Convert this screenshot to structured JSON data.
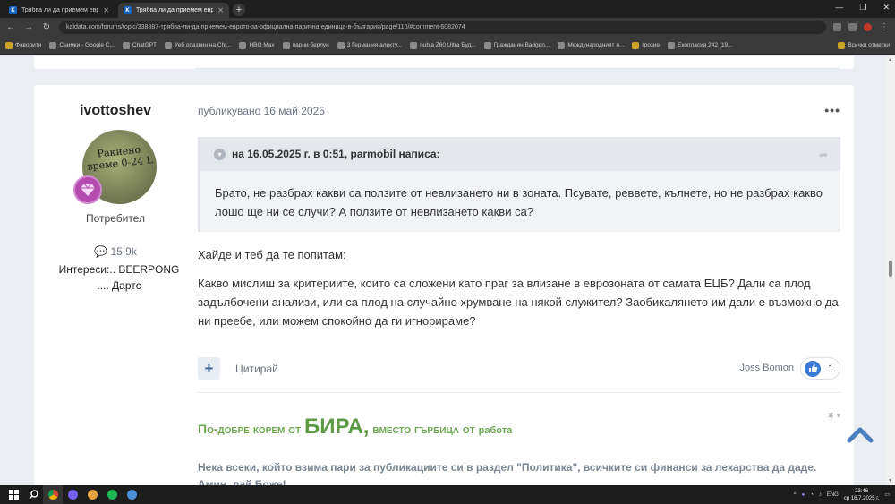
{
  "browser": {
    "tabs": [
      {
        "favicon": "K",
        "title": "Трябва ли да приемем еврото…",
        "active": false
      },
      {
        "favicon": "K",
        "title": "Трябва ли да приемем еврото…",
        "active": true
      }
    ],
    "url": "kaldata.com/forums/topic/338887-трябва-ли-да-приемем-еврото-за-официална-парична-единица-в-българия/page/110/#comment-6082074",
    "bookmarks": [
      {
        "label": "Фаворити",
        "type": "folder"
      },
      {
        "label": "Снимки - Google С...",
        "type": "link"
      },
      {
        "label": "ChatGPT",
        "type": "link"
      },
      {
        "label": "Уеб опазвин на Chr...",
        "type": "link"
      },
      {
        "label": "HBO Max",
        "type": "link"
      },
      {
        "label": "парни берлун",
        "type": "link"
      },
      {
        "label": "3 Германия алекту...",
        "type": "link"
      },
      {
        "label": "nubia Z60 Ultra Буд...",
        "type": "link"
      },
      {
        "label": "Гражданин Badgen...",
        "type": "link"
      },
      {
        "label": "Международният н...",
        "type": "link"
      },
      {
        "label": "грозие",
        "type": "folder"
      },
      {
        "label": "Екопласия 242 (19...",
        "type": "link"
      }
    ],
    "bookmarks_right": "Всички отметки"
  },
  "post": {
    "author": {
      "name": "ivottoshev",
      "avatar_text": "Ракиено време 0-24 L",
      "role": "Потребител",
      "reputation": "15,9k",
      "interests": "Интереси:.. BEERPONG .... Дартс"
    },
    "meta": "публикувано 16 май 2025",
    "menu_label": "•••",
    "quote": {
      "citation": "на 16.05.2025 г. в 0:51, parmobil написа:",
      "body": "Брато, не разбрах какви са ползите от невлизането ни в зоната. Псувате, реввете, кълнете, но не разбрах какво лошо ще ни се случи? А ползите от невлизането какви са?"
    },
    "paragraphs": [
      "Хайде и теб да те попитам:",
      "Какво мислиш за критериите, които са сложени като праг за влизане в еврозоната от самата ЕЦБ? Дали са плод задълбочени анализи, или са плод на случайно хрумване на някой служител? Заобикалянето им дали е възможно да ни преебе, или можем спокойно да ги игнорираме?"
    ],
    "actions": {
      "plus_label": "+",
      "quote_label": "Цитирай",
      "liker": "Joss Bomon",
      "like_count": "1"
    },
    "signature": {
      "part1": "По-добре корем от ",
      "part2": "БИРА,",
      "part3": " вместо гърбица от ",
      "part4": "работа",
      "text": "Нека всеки, който взима пари за публикациите си в раздел \"Политика\", всичките си финанси за лекарства да даде. Амин, дай Боже!",
      "controls": "✖ ▾"
    }
  },
  "taskbar": {
    "language": "ENG",
    "time": "23:46",
    "date": "ср 16.7.2025 г."
  },
  "icons": [
    "windows-icon",
    "search-icon",
    "chrome-icon",
    "viber-icon",
    "spotify-icon",
    "like-icon",
    "chevron-up-icon",
    "share-icon"
  ]
}
